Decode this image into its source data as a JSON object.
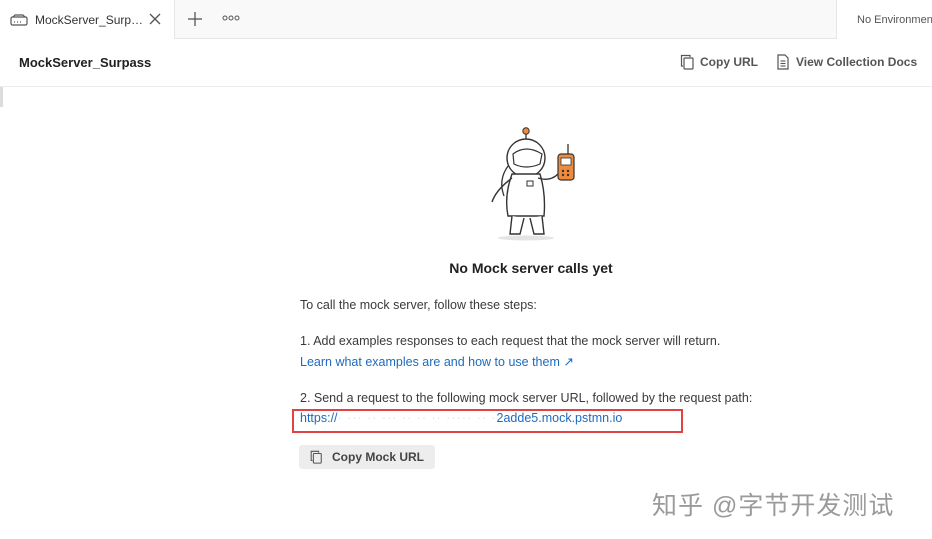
{
  "tabs": {
    "active_label": "MockServer_Surpass",
    "environment": "No Environment"
  },
  "header": {
    "title": "MockServer_Surpass",
    "copy_url_label": "Copy URL",
    "view_docs_label": "View Collection Docs"
  },
  "main": {
    "empty_title": "No Mock server calls yet",
    "intro": "To call the mock server, follow these steps:",
    "step1": "1. Add examples responses to each request that the mock server will return.",
    "learn_link": "Learn what examples are and how to use them ↗",
    "step2": "2. Send a request to the following mock server URL, followed by the request path:",
    "mock_url_prefix": "https://",
    "mock_url_suffix": "2adde5.mock.pstmn.io",
    "copy_mock_url_label": "Copy Mock URL"
  },
  "watermark": "知乎 @字节开发测试",
  "colors": {
    "link": "#1d6bbf",
    "highlight_border": "#e04343",
    "accent_orange": "#f08a3c"
  }
}
